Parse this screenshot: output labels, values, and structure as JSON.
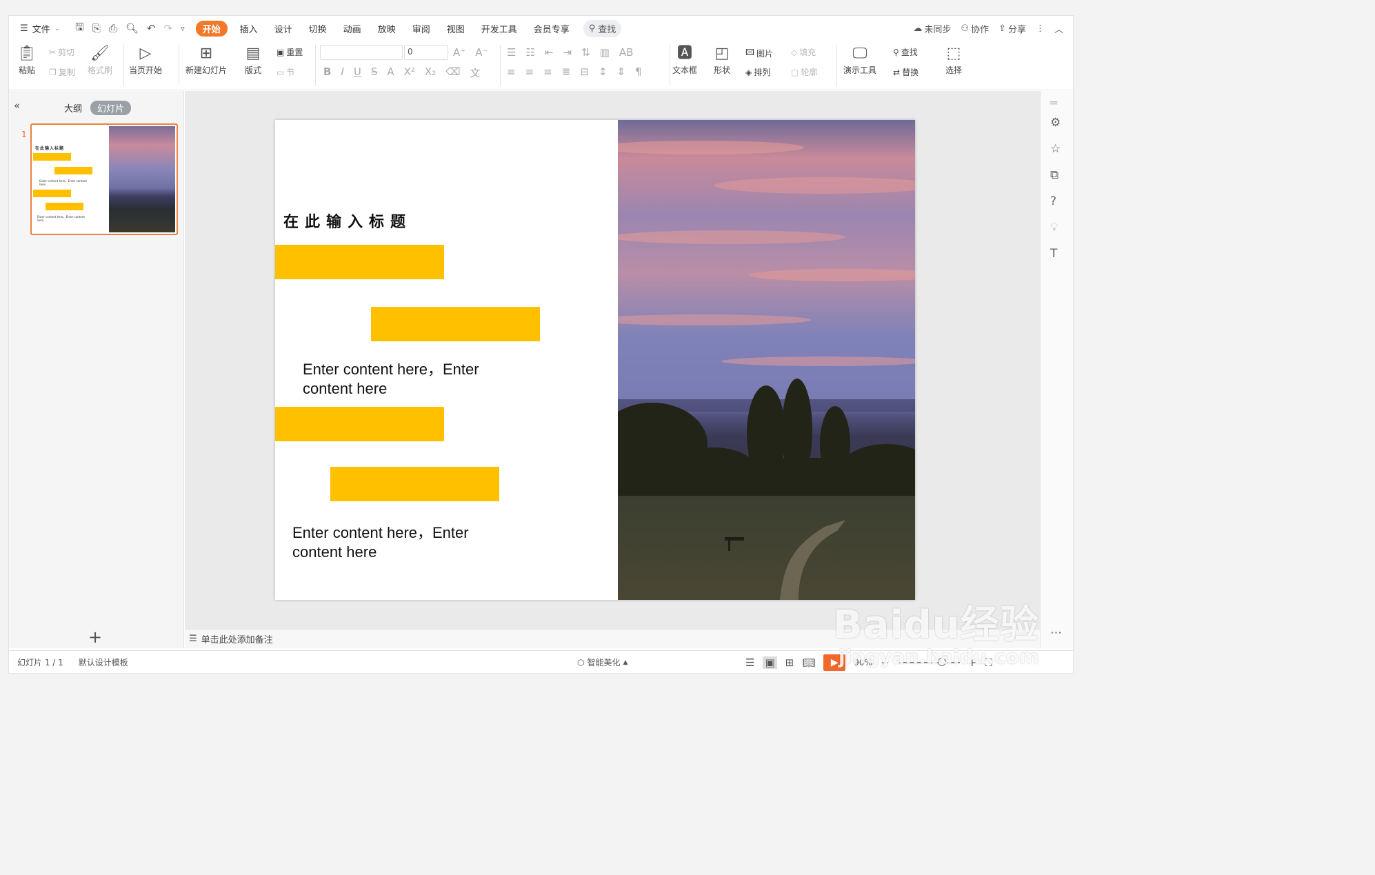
{
  "menu": {
    "file": "文件",
    "tabs": [
      "开始",
      "插入",
      "设计",
      "切换",
      "动画",
      "放映",
      "审阅",
      "视图",
      "开发工具",
      "会员专享"
    ],
    "active_tab": "开始",
    "search": "查找",
    "right": {
      "sync": "未同步",
      "collab": "协作",
      "share": "分享"
    }
  },
  "ribbon": {
    "paste": "粘贴",
    "cut": "剪切",
    "copy": "复制",
    "format_painter": "格式刷",
    "play_current": "当页开始",
    "new_slide": "新建幻灯片",
    "layout": "版式",
    "reset": "重置",
    "section": "节",
    "font_size": "0",
    "textbox": "文本框",
    "shape": "形状",
    "picture": "图片",
    "arrange": "排列",
    "fill": "填充",
    "outline": "轮廓",
    "present_tools": "演示工具",
    "find": "查找",
    "replace": "替换",
    "select": "选择"
  },
  "panel": {
    "outline_tab": "大纲",
    "slides_tab": "幻灯片",
    "slide_number": "1"
  },
  "slide": {
    "title": "在此输入标题",
    "body1": "Enter content here，Enter content here",
    "body2": "Enter content here，Enter content here"
  },
  "thumb": {
    "title": "在此输入标题",
    "body": "Enter content here，Enter content here"
  },
  "notes_placeholder": "单击此处添加备注",
  "status": {
    "slide_info": "幻灯片 1 / 1",
    "template": "默认设计模板",
    "beautify": "智能美化",
    "zoom": "90%"
  },
  "watermark": {
    "line1": "Baidu经验",
    "line2": "jingyan.baidu.com"
  },
  "colors": {
    "accent": "#f2782a",
    "bar": "#ffc000"
  }
}
